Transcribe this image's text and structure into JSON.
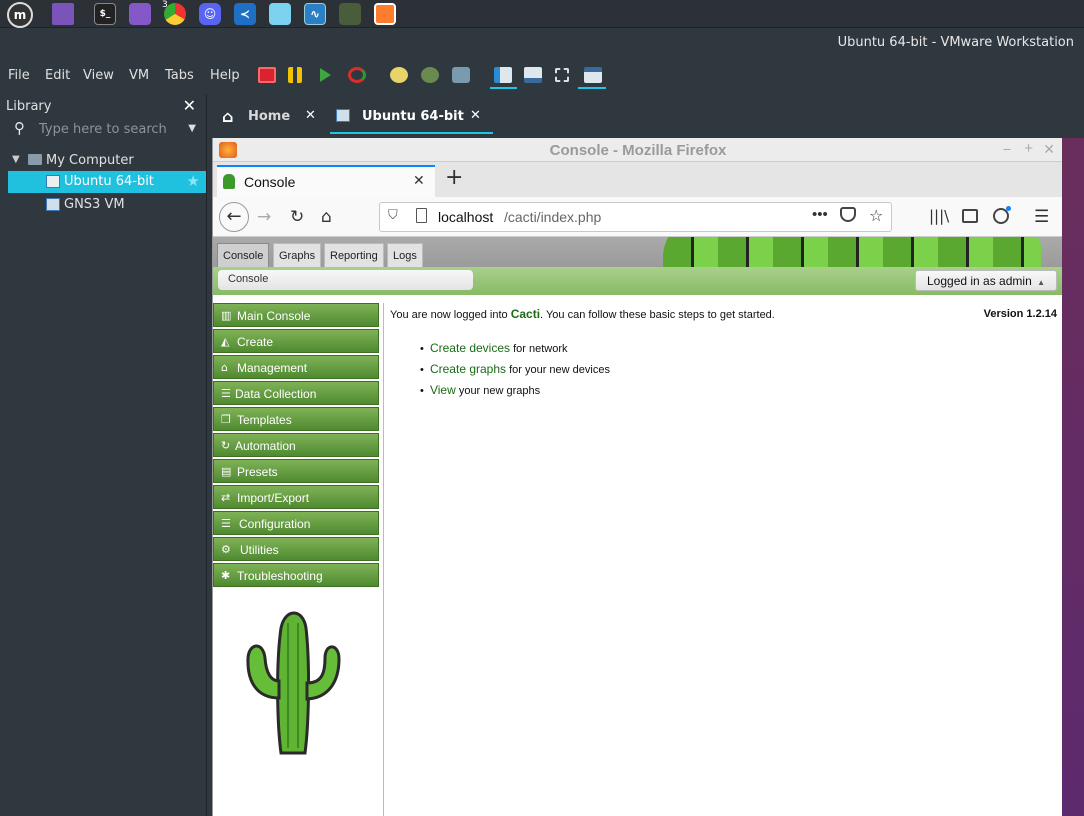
{
  "window_title": "Ubuntu 64-bit - VMware Workstation",
  "taskbar": {
    "badge": "3"
  },
  "menu": [
    "File",
    "Edit",
    "View",
    "VM",
    "Tabs",
    "Help"
  ],
  "library": {
    "title": "Library",
    "search_placeholder": "Type here to search",
    "my_computer": "My Computer",
    "vms": [
      "Ubuntu 64-bit",
      "GNS3 VM"
    ]
  },
  "vm_tabs": [
    {
      "label": "Home"
    },
    {
      "label": "Ubuntu 64-bit"
    }
  ],
  "firefox": {
    "title": "Console - Mozilla Firefox",
    "tab_title": "Console",
    "url_host": "localhost",
    "url_path": "/cacti/index.php"
  },
  "cacti": {
    "tabs": [
      "Console",
      "Graphs",
      "Reporting",
      "Logs"
    ],
    "breadcrumb": "Console",
    "logged_in": "Logged in as admin",
    "nav": [
      {
        "label": "Main Console",
        "icon": "map-icon"
      },
      {
        "label": "Create",
        "icon": "chart-icon"
      },
      {
        "label": "Management",
        "icon": "home-icon"
      },
      {
        "label": "Data Collection",
        "icon": "database-icon"
      },
      {
        "label": "Templates",
        "icon": "clone-icon"
      },
      {
        "label": "Automation",
        "icon": "refresh-icon"
      },
      {
        "label": "Presets",
        "icon": "list-icon"
      },
      {
        "label": "Import/Export",
        "icon": "exchange-icon"
      },
      {
        "label": "Configuration",
        "icon": "sliders-icon"
      },
      {
        "label": "Utilities",
        "icon": "cogs-icon"
      },
      {
        "label": "Troubleshooting",
        "icon": "bug-icon"
      }
    ],
    "welcome_pre": "You are now logged into ",
    "welcome_brand": "Cacti",
    "welcome_post": ". You can follow these basic steps to get started.",
    "version": "Version 1.2.14",
    "steps": [
      {
        "link": "Create devices",
        "text": " for network"
      },
      {
        "link": "Create graphs",
        "text": " for your new devices"
      },
      {
        "link": "View",
        "text": " your new graphs"
      }
    ]
  },
  "colors": {
    "accent": "#21c5e6",
    "cacti_green": "#1a6b15"
  }
}
